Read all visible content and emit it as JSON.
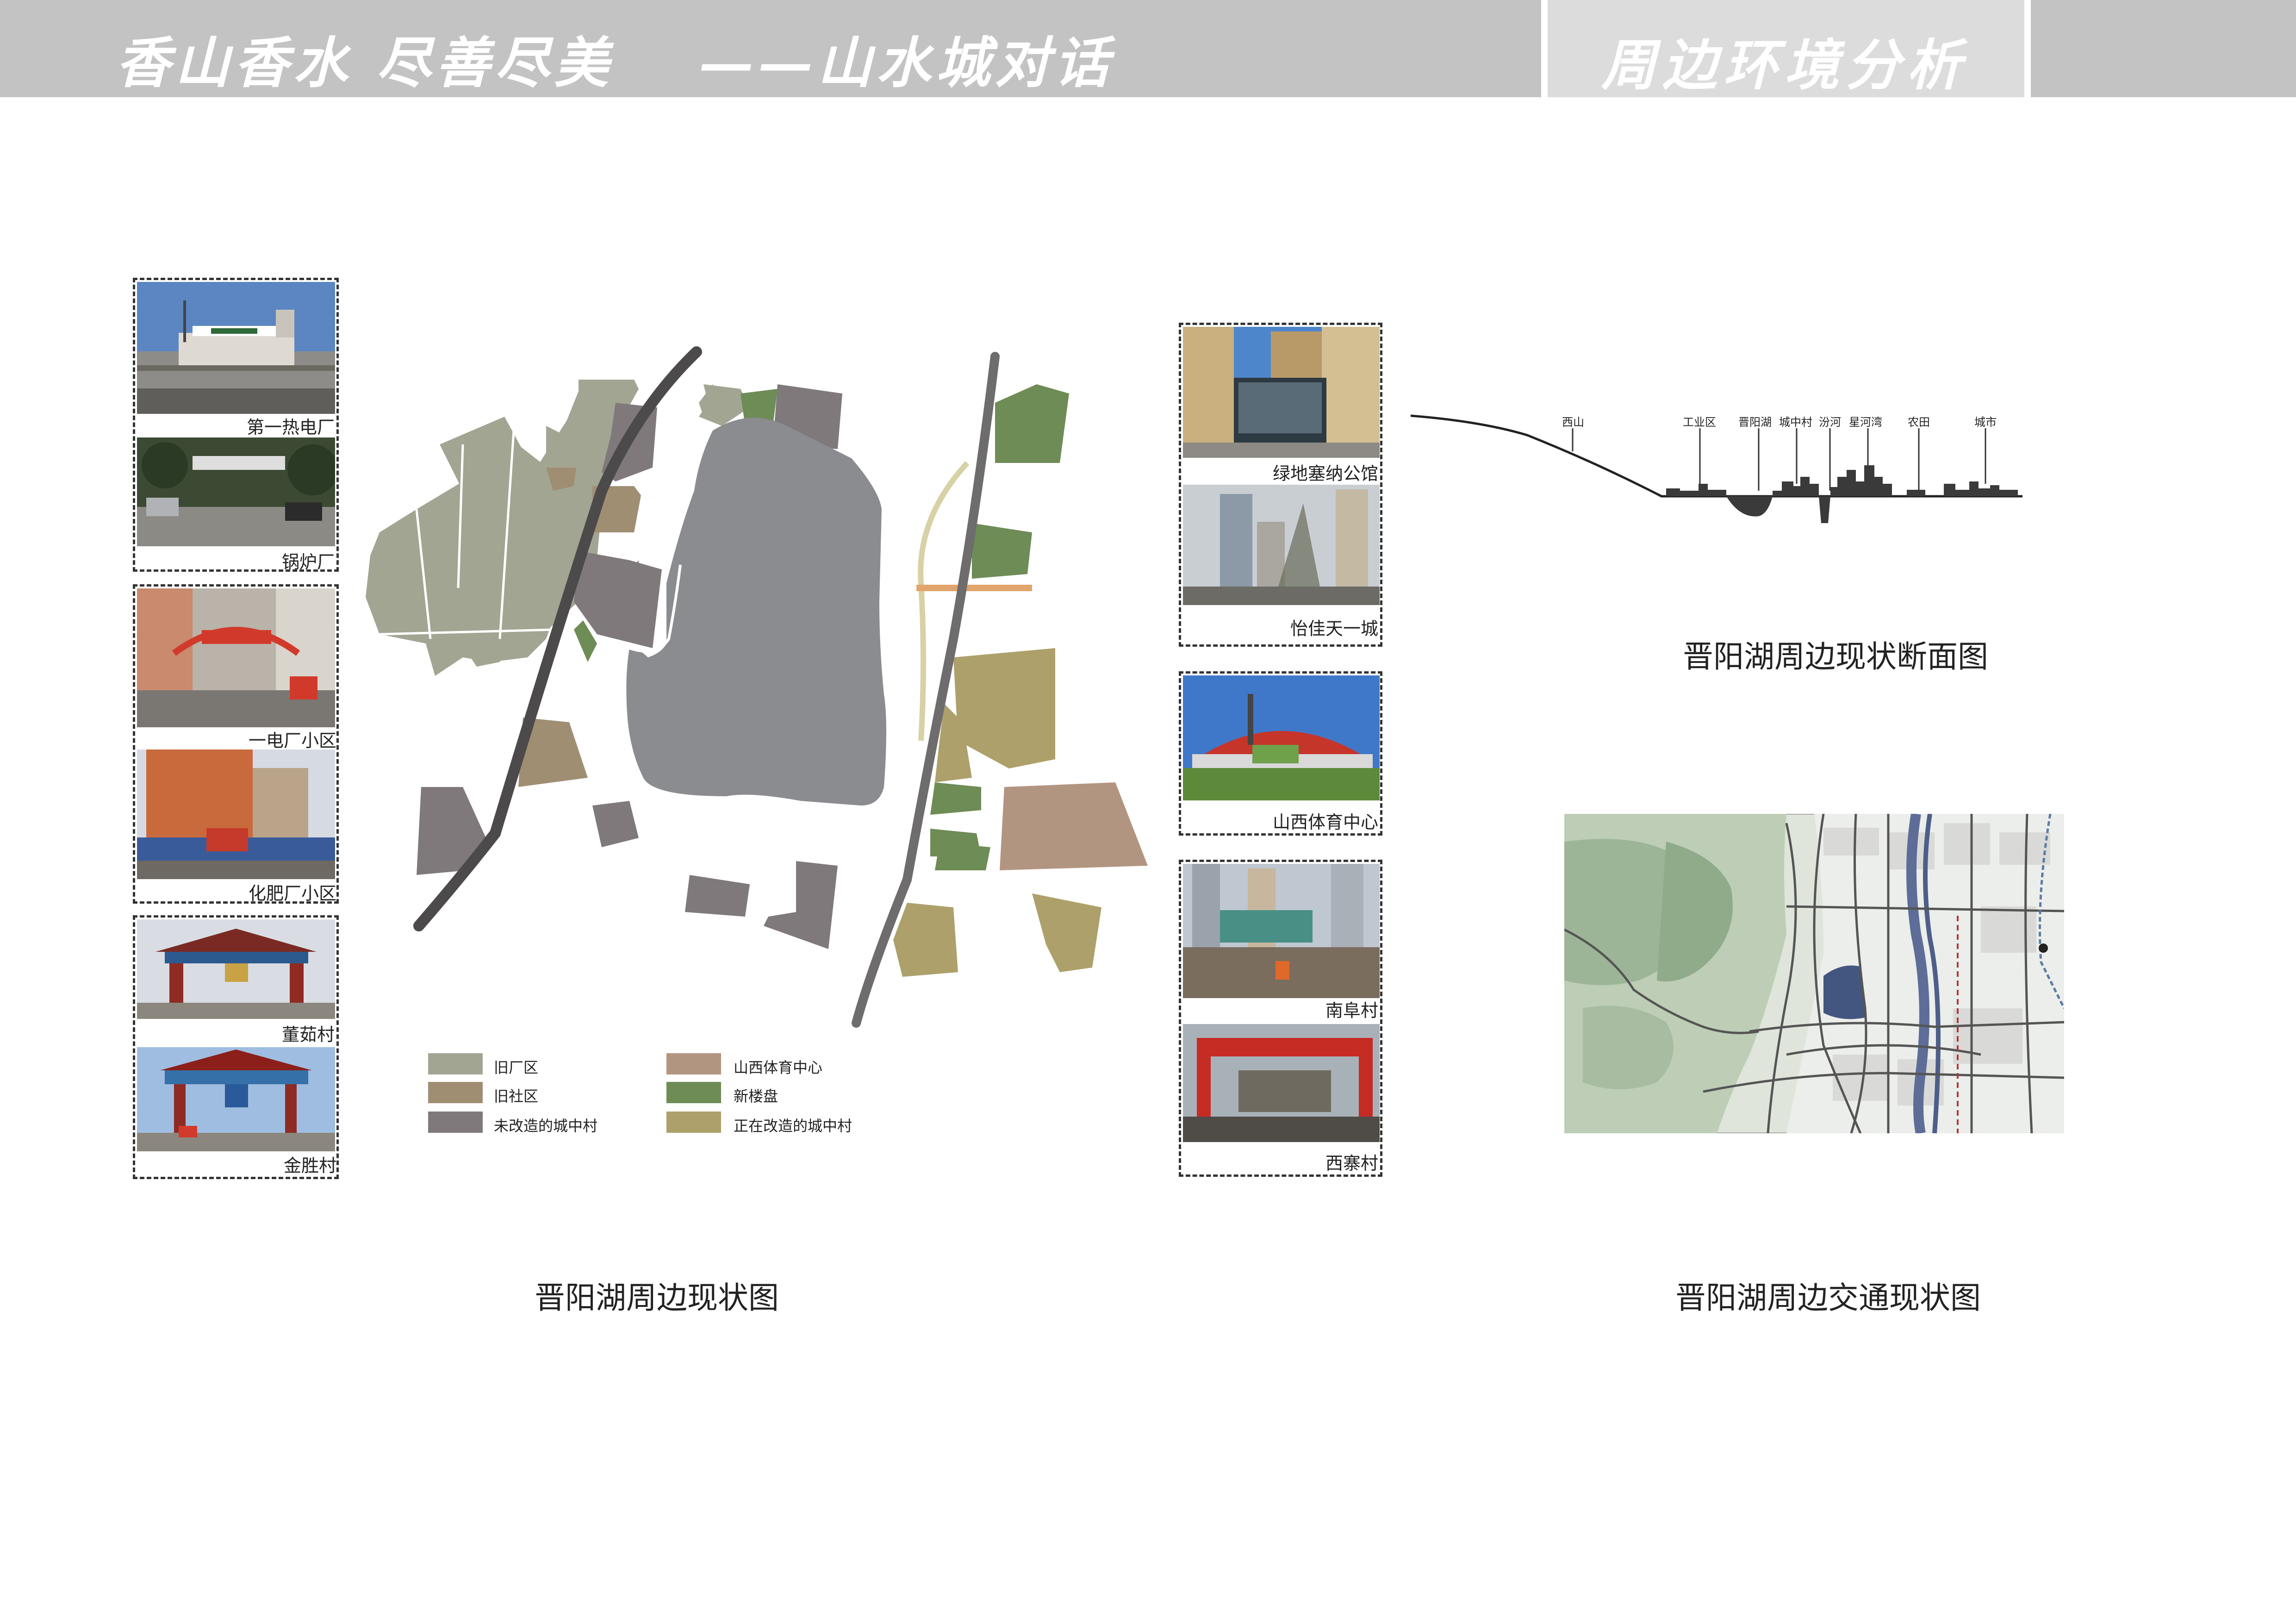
{
  "header": {
    "title": "香山香水 尽善尽美",
    "subtitle": "——山水城对话",
    "tab_label": "周边环境分析"
  },
  "left_photos": [
    {
      "caption": "第一热电厂"
    },
    {
      "caption": "锅炉厂"
    },
    {
      "caption": "一电厂小区"
    },
    {
      "caption": "化肥厂小区"
    },
    {
      "caption": "董茹村"
    },
    {
      "caption": "金胜村"
    }
  ],
  "right_photos": [
    {
      "caption": "绿地塞纳公馆"
    },
    {
      "caption": "怡佳天一城"
    },
    {
      "caption": "山西体育中心"
    },
    {
      "caption": "南阜村"
    },
    {
      "caption": "西寨村"
    }
  ],
  "map": {
    "title": "晋阳湖周边现状图",
    "legend": [
      {
        "label": "旧厂区",
        "color": "#a3a593"
      },
      {
        "label": "旧社区",
        "color": "#a08e73"
      },
      {
        "label": "未改造的城中村",
        "color": "#7f797b"
      },
      {
        "label": "山西体育中心",
        "color": "#b29580"
      },
      {
        "label": "新楼盘",
        "color": "#6e8c56"
      },
      {
        "label": "正在改造的城中村",
        "color": "#ada06a"
      }
    ]
  },
  "section": {
    "title": "晋阳湖周边现状断面图",
    "labels": [
      "西山",
      "工业区",
      "晋阳湖",
      "城中村",
      "汾河",
      "星河湾",
      "农田",
      "城市"
    ]
  },
  "traffic_map": {
    "title": "晋阳湖周边交通现状图"
  }
}
